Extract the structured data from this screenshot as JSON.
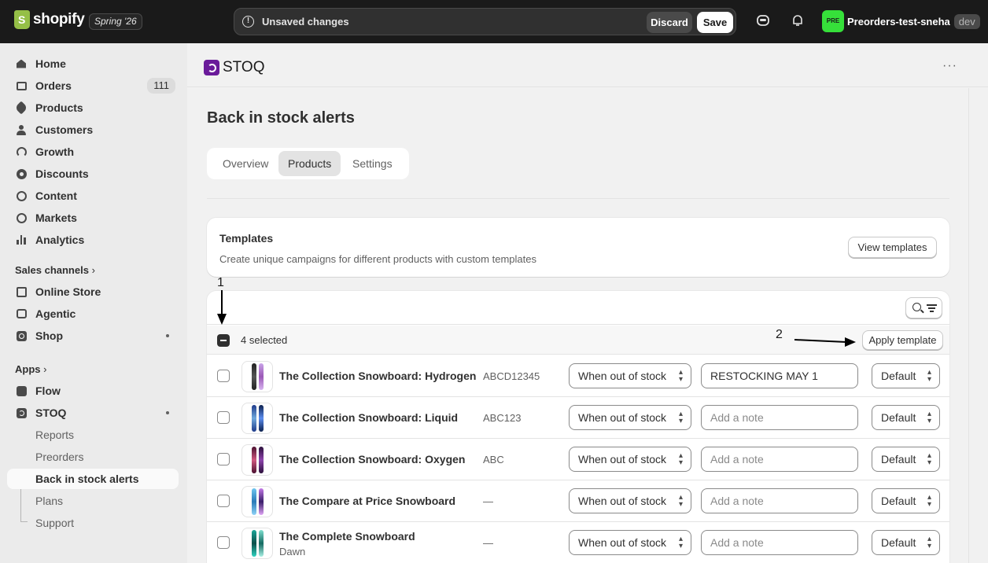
{
  "topbar": {
    "brand": "shopify",
    "season_badge": "Spring '26",
    "unsaved_text": "Unsaved changes",
    "discard_label": "Discard",
    "save_label": "Save",
    "store_avatar": "PRE",
    "store_name": "Preorders-test-sneha",
    "store_badge": "dev",
    "avatar_color": "#36e03a"
  },
  "sidebar": {
    "items": [
      {
        "label": "Home",
        "icon": "home-icon"
      },
      {
        "label": "Orders",
        "icon": "orders-icon",
        "count": "111"
      },
      {
        "label": "Products",
        "icon": "tag-icon"
      },
      {
        "label": "Customers",
        "icon": "person-icon"
      },
      {
        "label": "Growth",
        "icon": "growth-icon"
      },
      {
        "label": "Discounts",
        "icon": "discount-icon"
      },
      {
        "label": "Content",
        "icon": "content-icon"
      },
      {
        "label": "Markets",
        "icon": "globe-icon"
      },
      {
        "label": "Analytics",
        "icon": "bar-chart-icon"
      }
    ],
    "sales_channels_heading": "Sales channels",
    "sales_channels": [
      {
        "label": "Online Store",
        "icon": "store-icon"
      },
      {
        "label": "Agentic",
        "icon": "bot-icon"
      },
      {
        "label": "Shop",
        "icon": "shop-icon"
      }
    ],
    "apps_heading": "Apps",
    "apps": [
      {
        "label": "Flow",
        "icon": "flow-icon"
      },
      {
        "label": "STOQ",
        "icon": "stoq-icon"
      }
    ],
    "stoq_sub": [
      "Reports",
      "Preorders",
      "Back in stock alerts",
      "Plans",
      "Support"
    ]
  },
  "app": {
    "name": "STOQ",
    "more": "···",
    "page_title": "Back in stock alerts",
    "tabs": [
      "Overview",
      "Products",
      "Settings"
    ],
    "active_tab": "Products",
    "accent": "#6a1b9a"
  },
  "templates_card": {
    "title": "Templates",
    "description": "Create unique campaigns for different products with custom templates",
    "view_button": "View templates"
  },
  "table": {
    "selected_text": "4 selected",
    "apply_button": "Apply template",
    "rows": [
      {
        "name": "The Collection Snowboard: Hydrogen",
        "variant": "",
        "sku": "ABCD12345",
        "trigger": "When out of stock",
        "note": "RESTOCKING MAY 1",
        "template": "Default"
      },
      {
        "name": "The Collection Snowboard: Liquid",
        "variant": "",
        "sku": "ABC123",
        "trigger": "When out of stock",
        "note": "",
        "template": "Default"
      },
      {
        "name": "The Collection Snowboard: Oxygen",
        "variant": "",
        "sku": "ABC",
        "trigger": "When out of stock",
        "note": "",
        "template": "Default"
      },
      {
        "name": "The Compare at Price Snowboard",
        "variant": "",
        "sku": "—",
        "trigger": "When out of stock",
        "note": "",
        "template": "Default"
      },
      {
        "name": "The Complete Snowboard",
        "variant": "Dawn",
        "sku": "—",
        "trigger": "When out of stock",
        "note": "",
        "template": "Default"
      }
    ],
    "note_placeholder": "Add a note"
  },
  "annotations": {
    "marker_1": "1",
    "marker_2": "2"
  }
}
